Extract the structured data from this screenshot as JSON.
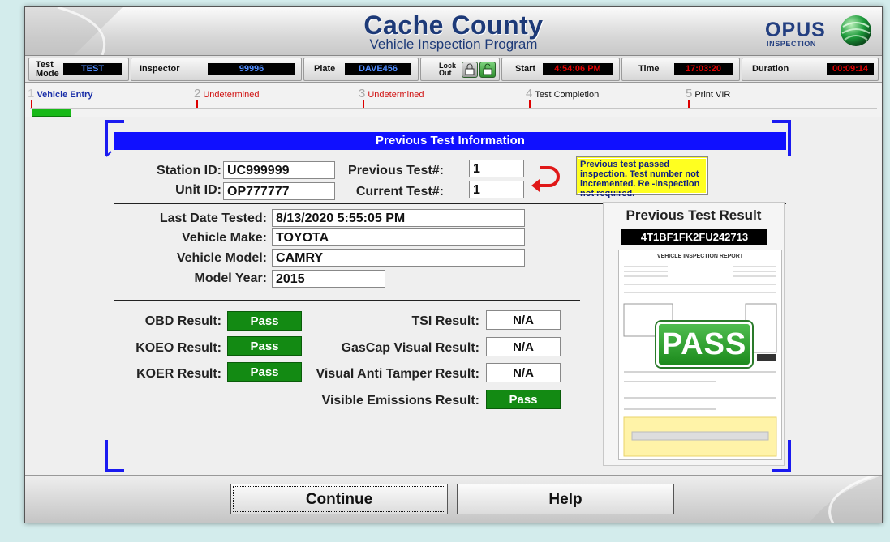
{
  "header": {
    "title": "Cache County",
    "subtitle": "Vehicle Inspection Program",
    "logo_text": "OPUS",
    "logo_sub": "INSPECTION"
  },
  "status": {
    "test_mode_label": "Test Mode",
    "test_mode_value": "TEST",
    "inspector_label": "Inspector",
    "inspector_value": "99996",
    "plate_label": "Plate",
    "plate_value": "DAVE456",
    "lockout_label": "Lock Out",
    "start_label": "Start",
    "start_value": "4:54:06 PM",
    "time_label": "Time",
    "time_value": "17:03:20",
    "duration_label": "Duration",
    "duration_value": "00:09:14"
  },
  "steps": [
    {
      "num": "1",
      "label": "Vehicle Entry"
    },
    {
      "num": "2",
      "label": "Undetermined"
    },
    {
      "num": "3",
      "label": "Undetermined"
    },
    {
      "num": "4",
      "label": "Test Completion"
    },
    {
      "num": "5",
      "label": "Print VIR"
    }
  ],
  "progress": 0.045,
  "section_title": "Previous Test Information",
  "fields": {
    "station_id_label": "Station ID:",
    "station_id": "UC999999",
    "unit_id_label": "Unit ID:",
    "unit_id": "OP777777",
    "prev_test_label": "Previous Test#:",
    "prev_test": "1",
    "curr_test_label": "Current Test#:",
    "curr_test": "1",
    "note": "Previous test passed inspection. Test number not incremented. Re -inspection not required.",
    "last_date_label": "Last Date Tested:",
    "last_date": "8/13/2020 5:55:05 PM",
    "make_label": "Vehicle Make:",
    "make": "TOYOTA",
    "model_label": "Vehicle Model:",
    "model": "CAMRY",
    "year_label": "Model Year:",
    "year": "2015"
  },
  "results": {
    "obd_label": "OBD Result:",
    "obd": "Pass",
    "koeo_label": "KOEO Result:",
    "koeo": "Pass",
    "koer_label": "KOER Result:",
    "koer": "Pass",
    "tsi_label": "TSI Result:",
    "tsi": "N/A",
    "gascap_label": "GasCap Visual Result:",
    "gascap": "N/A",
    "antitamper_label": "Visual Anti Tamper Result:",
    "antitamper": "N/A",
    "visible_label": "Visible Emissions Result:",
    "visible": "Pass"
  },
  "preview": {
    "title": "Previous Test Result",
    "vin": "4T1BF1FK2FU242713",
    "doc_title": "VEHICLE INSPECTION REPORT",
    "stamp": "PASS"
  },
  "buttons": {
    "continue": "Continue",
    "help": "Help"
  },
  "colors": {
    "banner": "#1010ff",
    "pass": "#138a13",
    "note": "#ffff20",
    "title": "#1d3a78"
  }
}
